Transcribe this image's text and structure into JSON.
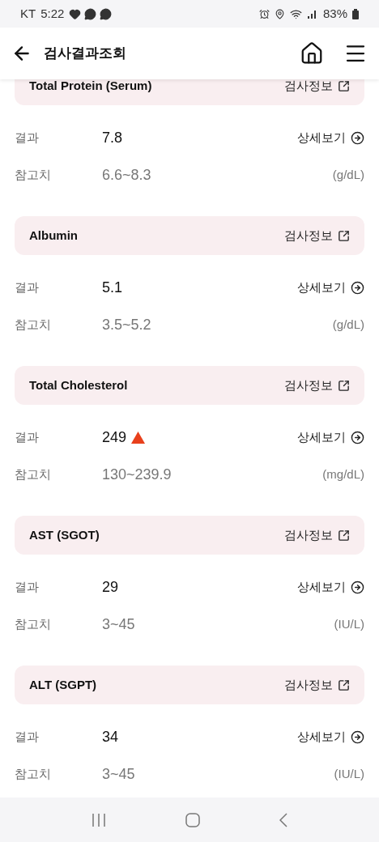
{
  "status_bar": {
    "carrier": "KT",
    "time": "5:22",
    "battery": "83%"
  },
  "header": {
    "title": "검사결과조회"
  },
  "tests": [
    {
      "name": "Total Protein (Serum)",
      "info_link": "검사정보",
      "result_label": "결과",
      "result": "7.8",
      "high": false,
      "detail_link": "상세보기",
      "ref_label": "참고치",
      "ref_range": "6.6~8.3",
      "unit": "(g/dL)"
    },
    {
      "name": "Albumin",
      "info_link": "검사정보",
      "result_label": "결과",
      "result": "5.1",
      "high": false,
      "detail_link": "상세보기",
      "ref_label": "참고치",
      "ref_range": "3.5~5.2",
      "unit": "(g/dL)"
    },
    {
      "name": "Total Cholesterol",
      "info_link": "검사정보",
      "result_label": "결과",
      "result": "249",
      "high": true,
      "detail_link": "상세보기",
      "ref_label": "참고치",
      "ref_range": "130~239.9",
      "unit": "(mg/dL)"
    },
    {
      "name": "AST (SGOT)",
      "info_link": "검사정보",
      "result_label": "결과",
      "result": "29",
      "high": false,
      "detail_link": "상세보기",
      "ref_label": "참고치",
      "ref_range": "3~45",
      "unit": "(IU/L)"
    },
    {
      "name": "ALT (SGPT)",
      "info_link": "검사정보",
      "result_label": "결과",
      "result": "34",
      "high": false,
      "detail_link": "상세보기",
      "ref_label": "참고치",
      "ref_range": "3~45",
      "unit": "(IU/L)"
    }
  ]
}
